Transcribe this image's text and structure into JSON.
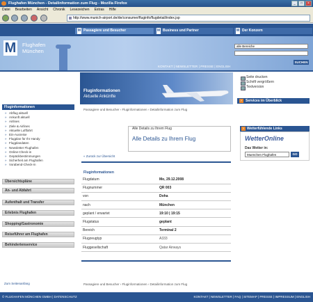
{
  "browser": {
    "title": "Flughafen München - Detailinformation zum Flug - Mozilla Firefox",
    "menu": [
      "Datei",
      "Bearbeiten",
      "Ansicht",
      "Chronik",
      "Lesezeichen",
      "Extras",
      "Hilfe"
    ],
    "url": "http://www.munich-airport.de/de/consumer/fluginfo/flugdetail/index.jsp"
  },
  "header": {
    "tabs": [
      "Passagiere und Besucher",
      "Business und Partner",
      "Der Konzern"
    ],
    "tab_marker": "M",
    "logo_letter": "M",
    "logo_line1": "Flughafen",
    "logo_line2": "München",
    "search_select": "alle Bereiche",
    "search_button": "SUCHEN",
    "util_nav": "KONTAKT | NEWSLETTER | PRESSE | ENGLISH"
  },
  "sidebar": {
    "section_title": "Fluginformationen",
    "items": [
      "Abflug aktuell",
      "Ankunft aktuell",
      "Airlines",
      "Ziele & Airlines",
      "Aktuelle Luftfahrt",
      "Ein-Ausreise",
      "Flugplan für Ihr Handy",
      "Flugplandaten",
      "Newsletter Flughafen",
      "Online-Check-in",
      "Gepäckbestimmungen",
      "Sicherheit am Flughafen",
      "Vorabend-Check-in"
    ],
    "buttons": [
      "Übersichtspläne",
      "An- und Abfahrt",
      "Aufenthalt und Transfer",
      "Erlebnis Flughafen",
      "Shopping/Gastronomie",
      "Reiseführer am Flughafen",
      "Behindertenservice"
    ],
    "sitemap": "Zum Seitenanfang"
  },
  "banner": {
    "title": "Fluginformationen",
    "subtitle": "Aktuelle Ankünfte"
  },
  "breadcrumb": "Passagiere und Besucher  ›  Fluginformationen  ›  Detailinformation zum Flug",
  "content": {
    "tab_label": "Alle Details zu Ihrem Flug",
    "title": "Alle Details zu Ihrem Flug",
    "back_link": "« Zurück zur Übersicht",
    "section": "Fluginformationen",
    "rows": [
      {
        "label": "Flugdatum",
        "value": "Mo, 29.12.2008"
      },
      {
        "label": "Flugnummer",
        "value": "QR 003"
      },
      {
        "label": "von",
        "value": "Doha"
      },
      {
        "label": "nach",
        "value": "München"
      },
      {
        "label": "geplant / erwartet",
        "value": "19:10 | 19:15"
      },
      {
        "label": "Flugstatus",
        "value": "geplant"
      },
      {
        "label": "Bereich",
        "value": "Terminal 2"
      },
      {
        "label": "Flugzeugtyp",
        "value": "A333"
      },
      {
        "label": "Fluggesellschaft",
        "value": "Qatar Airways"
      }
    ]
  },
  "services": {
    "items": [
      "Seite drucken",
      "Schrift vergrößern",
      "Textversion"
    ],
    "overview": "Services im Überblick"
  },
  "weather": {
    "header": "Wetterfühlende Links",
    "logo": "WetterOnline",
    "label": "Das Wetter in:",
    "input": "Muenchen Flughafen",
    "go": "GO"
  },
  "footer": {
    "left": "© FLUGHAFEN MÜNCHEN GMBH  |  DATENSCHUTZ",
    "right": "KONTAKT | NEWSLETTER | FAQ | SITEMAP | PRESSE | IMPRESSUM | ENGLISH"
  },
  "colors": {
    "brand": "#2a5592",
    "accent": "#e8862b"
  }
}
